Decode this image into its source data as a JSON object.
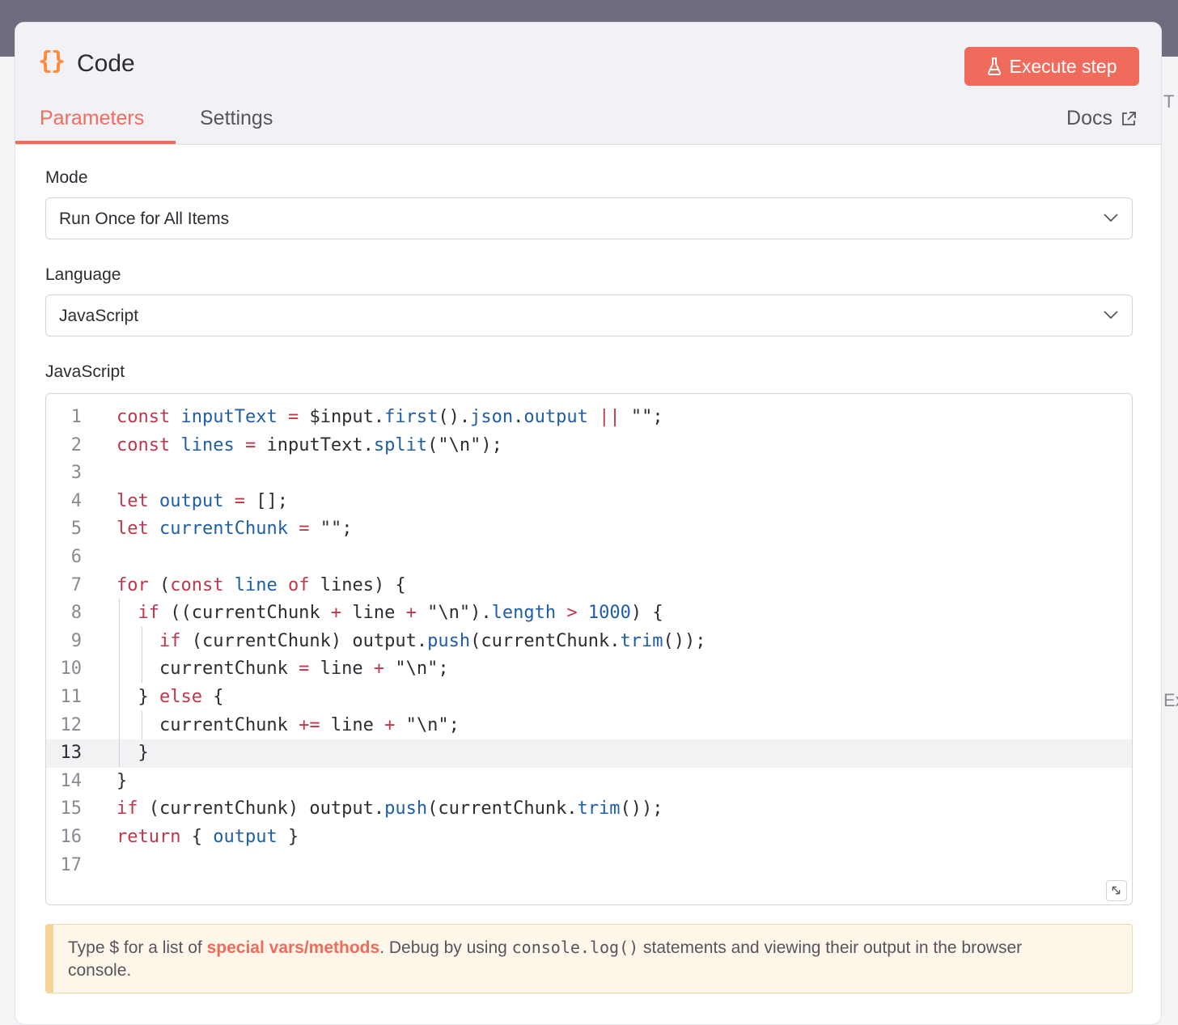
{
  "colors": {
    "accent": "#f06b5b",
    "brace_icon": "#ff8a3d",
    "keyword": "#c0364a",
    "identifier": "#1e5ea8"
  },
  "header": {
    "icon": "braces-icon",
    "title": "Code",
    "execute_label": "Execute step",
    "execute_icon": "flask-icon"
  },
  "tabs": [
    {
      "label": "Parameters",
      "active": true
    },
    {
      "label": "Settings",
      "active": false
    }
  ],
  "docs": {
    "label": "Docs",
    "icon": "external-link-icon"
  },
  "edge_letters": [
    "T",
    "Ex"
  ],
  "fields": {
    "mode": {
      "label": "Mode",
      "value": "Run Once for All Items"
    },
    "language": {
      "label": "Language",
      "value": "JavaScript"
    }
  },
  "editor": {
    "label": "JavaScript",
    "active_line": 13,
    "lines": [
      [
        [
          "k",
          "const"
        ],
        [
          "t",
          " "
        ],
        [
          "v",
          "inputText"
        ],
        [
          "t",
          " "
        ],
        [
          "o",
          "="
        ],
        [
          "t",
          " $input."
        ],
        [
          "v",
          "first"
        ],
        [
          "t",
          "()."
        ],
        [
          "v",
          "json"
        ],
        [
          "t",
          "."
        ],
        [
          "v",
          "output"
        ],
        [
          "t",
          " "
        ],
        [
          "o",
          "||"
        ],
        [
          "t",
          " \"\";"
        ]
      ],
      [
        [
          "k",
          "const"
        ],
        [
          "t",
          " "
        ],
        [
          "v",
          "lines"
        ],
        [
          "t",
          " "
        ],
        [
          "o",
          "="
        ],
        [
          "t",
          " inputText."
        ],
        [
          "v",
          "split"
        ],
        [
          "t",
          "(\"\\n\");"
        ]
      ],
      [],
      [
        [
          "k",
          "let"
        ],
        [
          "t",
          " "
        ],
        [
          "v",
          "output"
        ],
        [
          "t",
          " "
        ],
        [
          "o",
          "="
        ],
        [
          "t",
          " [];"
        ]
      ],
      [
        [
          "k",
          "let"
        ],
        [
          "t",
          " "
        ],
        [
          "v",
          "currentChunk"
        ],
        [
          "t",
          " "
        ],
        [
          "o",
          "="
        ],
        [
          "t",
          " \"\";"
        ]
      ],
      [],
      [
        [
          "k",
          "for"
        ],
        [
          "t",
          " ("
        ],
        [
          "k",
          "const"
        ],
        [
          "t",
          " "
        ],
        [
          "v",
          "line"
        ],
        [
          "t",
          " "
        ],
        [
          "k",
          "of"
        ],
        [
          "t",
          " lines) {"
        ]
      ],
      [
        [
          "t",
          "  "
        ],
        [
          "k",
          "if"
        ],
        [
          "t",
          " ((currentChunk "
        ],
        [
          "o",
          "+"
        ],
        [
          "t",
          " line "
        ],
        [
          "o",
          "+"
        ],
        [
          "t",
          " \"\\n\")."
        ],
        [
          "v",
          "length"
        ],
        [
          "t",
          " "
        ],
        [
          "o",
          ">"
        ],
        [
          "t",
          " "
        ],
        [
          "v",
          "1000"
        ],
        [
          "t",
          ") {"
        ]
      ],
      [
        [
          "t",
          "    "
        ],
        [
          "k",
          "if"
        ],
        [
          "t",
          " (currentChunk) output."
        ],
        [
          "v",
          "push"
        ],
        [
          "t",
          "(currentChunk."
        ],
        [
          "v",
          "trim"
        ],
        [
          "t",
          "());"
        ]
      ],
      [
        [
          "t",
          "    currentChunk "
        ],
        [
          "o",
          "="
        ],
        [
          "t",
          " line "
        ],
        [
          "o",
          "+"
        ],
        [
          "t",
          " \"\\n\";"
        ]
      ],
      [
        [
          "t",
          "  } "
        ],
        [
          "k",
          "else"
        ],
        [
          "t",
          " {"
        ]
      ],
      [
        [
          "t",
          "    currentChunk "
        ],
        [
          "o",
          "+="
        ],
        [
          "t",
          " line "
        ],
        [
          "o",
          "+"
        ],
        [
          "t",
          " \"\\n\";"
        ]
      ],
      [
        [
          "t",
          "  }"
        ]
      ],
      [
        [
          "t",
          "}"
        ]
      ],
      [
        [
          "k",
          "if"
        ],
        [
          "t",
          " (currentChunk) output."
        ],
        [
          "v",
          "push"
        ],
        [
          "t",
          "(currentChunk."
        ],
        [
          "v",
          "trim"
        ],
        [
          "t",
          "());"
        ]
      ],
      [
        [
          "k",
          "return"
        ],
        [
          "t",
          " { "
        ],
        [
          "v",
          "output"
        ],
        [
          "t",
          " }"
        ]
      ],
      []
    ],
    "resize_icon": "resize-icon"
  },
  "hint": {
    "before": "Type $ for a list of ",
    "link": "special vars/methods",
    "middle": ". Debug by using ",
    "code": "console.log()",
    "after": " statements and viewing their output in the browser console."
  }
}
